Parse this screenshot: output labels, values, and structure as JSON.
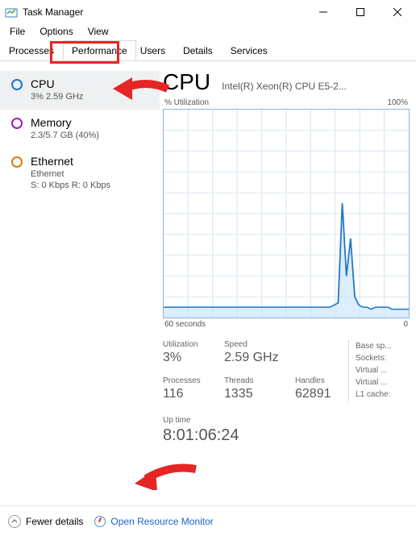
{
  "window": {
    "title": "Task Manager"
  },
  "menu": {
    "file": "File",
    "options": "Options",
    "view": "View"
  },
  "tabs": {
    "processes": "Processes",
    "performance": "Performance",
    "users": "Users",
    "details": "Details",
    "services": "Services"
  },
  "sidebar": {
    "cpu": {
      "name": "CPU",
      "sub": "3%  2.59 GHz"
    },
    "memory": {
      "name": "Memory",
      "sub": "2.3/5.7 GB (40%)"
    },
    "ethernet": {
      "name": "Ethernet",
      "sub1": "Ethernet",
      "sub2": "S: 0 Kbps  R: 0 Kbps"
    }
  },
  "content": {
    "heading": "CPU",
    "model": "Intel(R) Xeon(R) CPU E5-2...",
    "chart_top_left": "% Utilization",
    "chart_top_right": "100%",
    "chart_bottom_left": "60 seconds",
    "chart_bottom_right": "0"
  },
  "stats": {
    "util_label": "Utilization",
    "util_value": "3%",
    "speed_label": "Speed",
    "speed_value": "2.59 GHz",
    "proc_label": "Processes",
    "proc_value": "116",
    "threads_label": "Threads",
    "threads_value": "1335",
    "handles_label": "Handles",
    "handles_value": "62891",
    "base_label": "Base sp...",
    "sockets_label": "Sockets:",
    "virtual1_label": "Virtual ...",
    "virtual2_label": "Virtual ...",
    "l1_label": "L1 cache:",
    "uptime_label": "Up time",
    "uptime_value": "8:01:06:24"
  },
  "footer": {
    "fewer": "Fewer details",
    "orm": "Open Resource Monitor"
  },
  "chart_data": {
    "type": "line",
    "title": "% Utilization",
    "xlabel": "seconds",
    "ylabel": "% Utilization",
    "ylim": [
      0,
      100
    ],
    "x_left": 60,
    "x_right": 0,
    "values": [
      5,
      5,
      5,
      5,
      5,
      5,
      5,
      5,
      5,
      5,
      5,
      5,
      5,
      5,
      5,
      5,
      5,
      5,
      5,
      5,
      5,
      5,
      5,
      5,
      5,
      5,
      5,
      5,
      5,
      5,
      5,
      5,
      5,
      5,
      5,
      5,
      5,
      5,
      5,
      5,
      5,
      6,
      7,
      55,
      20,
      38,
      10,
      6,
      5,
      5,
      4,
      5,
      5,
      5,
      5,
      4,
      4,
      4,
      4,
      4
    ]
  }
}
